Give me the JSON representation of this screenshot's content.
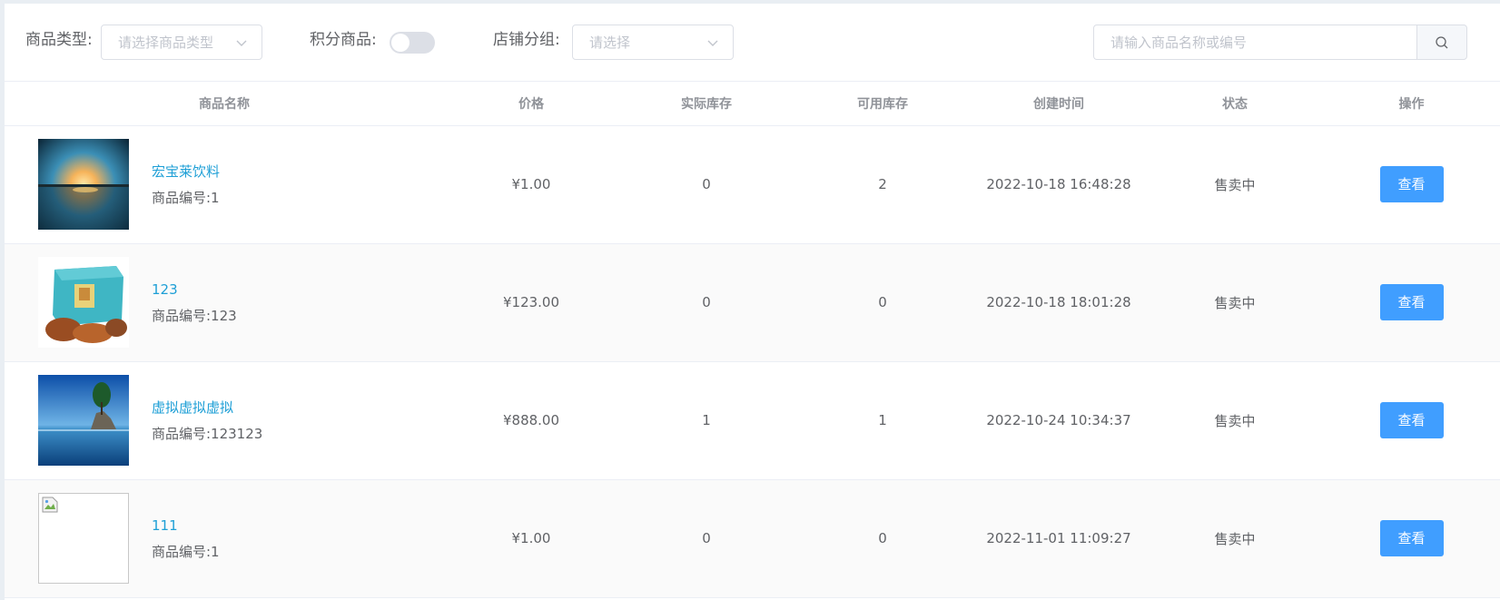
{
  "filters": {
    "type_label": "商品类型:",
    "type_placeholder": "请选择商品类型",
    "points_label": "积分商品:",
    "group_label": "店铺分组:",
    "group_placeholder": "请选择",
    "search_placeholder": "请输入商品名称或编号"
  },
  "table": {
    "headers": [
      "商品名称",
      "价格",
      "实际库存",
      "可用库存",
      "创建时间",
      "状态",
      "操作"
    ],
    "rows": [
      {
        "name": "宏宝莱饮料",
        "code": "商品编号:1",
        "price": "¥1.00",
        "actual_stock": "0",
        "available_stock": "2",
        "created": "2022-10-18 16:48:28",
        "status": "售卖中",
        "action": "查看"
      },
      {
        "name": "123",
        "code": "商品编号:123",
        "price": "¥123.00",
        "actual_stock": "0",
        "available_stock": "0",
        "created": "2022-10-18 18:01:28",
        "status": "售卖中",
        "action": "查看"
      },
      {
        "name": "虚拟虚拟虚拟",
        "code": "商品编号:123123",
        "price": "¥888.00",
        "actual_stock": "1",
        "available_stock": "1",
        "created": "2022-10-24 10:34:37",
        "status": "售卖中",
        "action": "查看"
      },
      {
        "name": "111",
        "code": "商品编号:1",
        "price": "¥1.00",
        "actual_stock": "0",
        "available_stock": "0",
        "created": "2022-11-01 11:09:27",
        "status": "售卖中",
        "action": "查看"
      }
    ]
  },
  "colors": {
    "primary": "#409eff",
    "link": "#1e9fd6"
  }
}
